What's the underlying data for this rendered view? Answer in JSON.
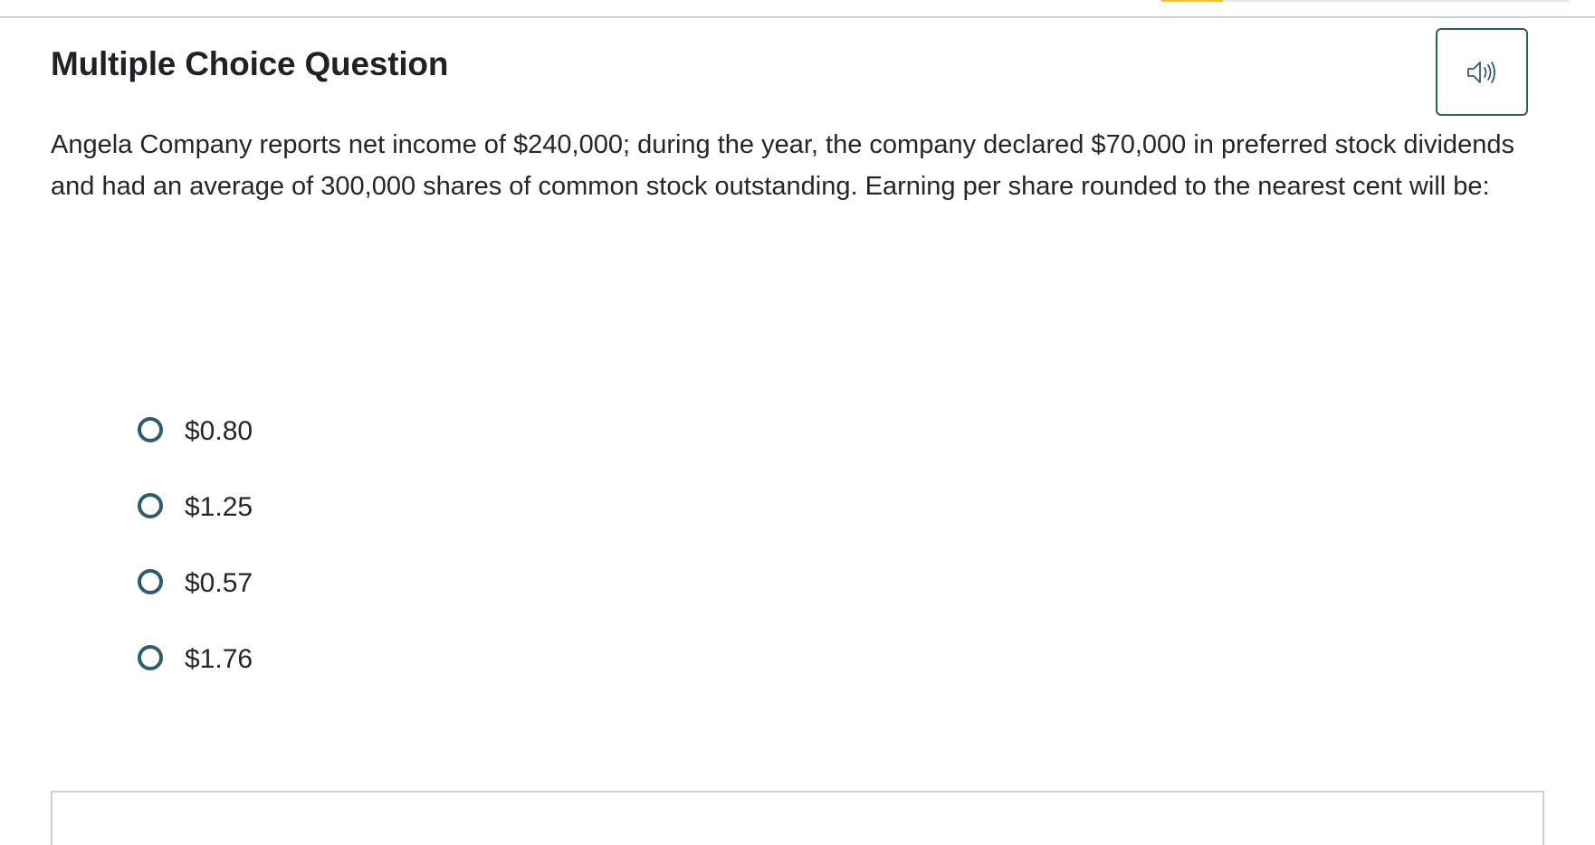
{
  "header": {
    "progress": 0.15
  },
  "question": {
    "type_label": "Multiple Choice Question",
    "audio_icon": "speaker-icon",
    "prompt": "Angela Company reports net income of $240,000; during the year, the company declared $70,000 in preferred stock dividends and had an average of 300,000 shares of common stock outstanding. Earning per share rounded to the nearest cent will be:",
    "options": [
      {
        "label": "$0.80",
        "selected": false
      },
      {
        "label": "$1.25",
        "selected": false
      },
      {
        "label": "$0.57",
        "selected": false
      },
      {
        "label": "$1.76",
        "selected": false
      }
    ]
  },
  "colors": {
    "accent": "#2f5c6b",
    "progress": "#f3c21b",
    "rule": "#c7d3d9",
    "text": "#1f2326"
  }
}
